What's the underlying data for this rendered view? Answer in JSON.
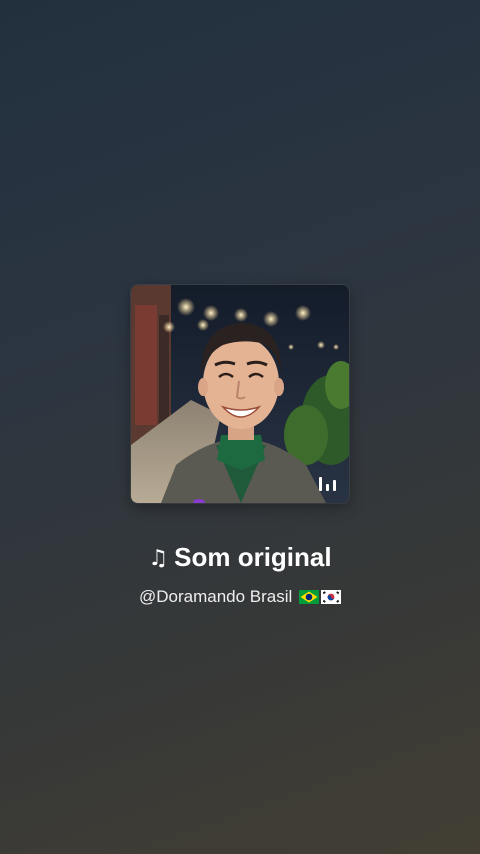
{
  "sound": {
    "title_icon": "music-note-icon",
    "title_icon_glyph": "♫",
    "title": "Som original",
    "author": "@Doramando Brasil",
    "flags": [
      "brazil-flag-icon",
      "south-korea-flag-icon"
    ]
  },
  "cover": {
    "description_icon": "playing-equalizer-icon"
  },
  "colors": {
    "background_top": "#22303e",
    "background_bottom": "#423e33",
    "text": "#ffffff",
    "accent": "#8a3bd0"
  }
}
